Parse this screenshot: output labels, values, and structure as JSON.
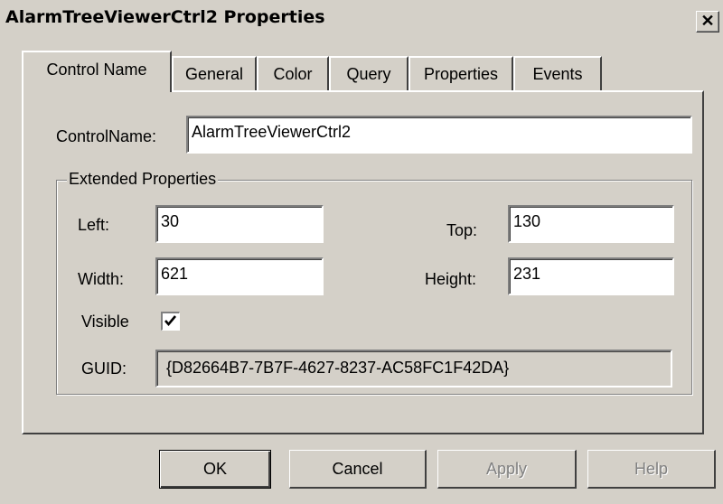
{
  "window": {
    "title": "AlarmTreeViewerCtrl2 Properties",
    "close_label": "✕"
  },
  "tabs": [
    {
      "label": "Control Name"
    },
    {
      "label": "General"
    },
    {
      "label": "Color"
    },
    {
      "label": "Query"
    },
    {
      "label": "Properties"
    },
    {
      "label": "Events"
    }
  ],
  "form": {
    "control_name_label": "ControlName:",
    "control_name_value": "AlarmTreeViewerCtrl2",
    "group_title": "Extended Properties",
    "left_label": "Left:",
    "left_value": "30",
    "top_label": "Top:",
    "top_value": "130",
    "width_label": "Width:",
    "width_value": "621",
    "height_label": "Height:",
    "height_value": "231",
    "visible_label": "Visible",
    "visible_checked": true,
    "guid_label": "GUID:",
    "guid_value": "{D82664B7-7B7F-4627-8237-AC58FC1F42DA}"
  },
  "buttons": {
    "ok": "OK",
    "cancel": "Cancel",
    "apply": "Apply",
    "help": "Help"
  }
}
